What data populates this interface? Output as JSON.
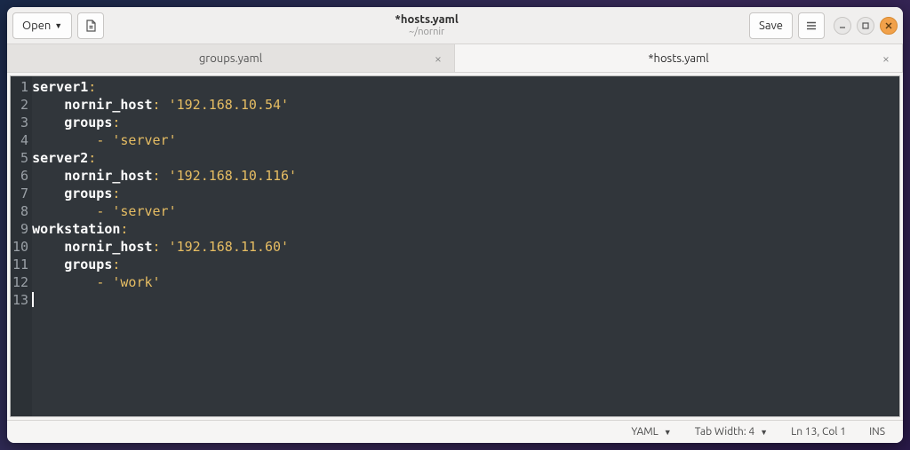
{
  "header": {
    "open_label": "Open",
    "save_label": "Save",
    "title": "*hosts.yaml",
    "subtitle": "~/nornir"
  },
  "tabs": [
    {
      "label": "groups.yaml",
      "active": false
    },
    {
      "label": "*hosts.yaml",
      "active": true
    }
  ],
  "editor": {
    "lines": [
      {
        "n": 1,
        "segments": [
          [
            "k",
            "server1"
          ],
          [
            "o",
            ":"
          ]
        ]
      },
      {
        "n": 2,
        "segments": [
          [
            "p",
            "    "
          ],
          [
            "k",
            "nornir_host"
          ],
          [
            "o",
            ":"
          ],
          [
            "p",
            " "
          ],
          [
            "s",
            "'192.168.10.54'"
          ]
        ]
      },
      {
        "n": 3,
        "segments": [
          [
            "p",
            "    "
          ],
          [
            "k",
            "groups"
          ],
          [
            "o",
            ":"
          ]
        ]
      },
      {
        "n": 4,
        "segments": [
          [
            "p",
            "        "
          ],
          [
            "o",
            "-"
          ],
          [
            "p",
            " "
          ],
          [
            "s",
            "'server'"
          ]
        ]
      },
      {
        "n": 5,
        "segments": [
          [
            "k",
            "server2"
          ],
          [
            "o",
            ":"
          ]
        ]
      },
      {
        "n": 6,
        "segments": [
          [
            "p",
            "    "
          ],
          [
            "k",
            "nornir_host"
          ],
          [
            "o",
            ":"
          ],
          [
            "p",
            " "
          ],
          [
            "s",
            "'192.168.10.116'"
          ]
        ]
      },
      {
        "n": 7,
        "segments": [
          [
            "p",
            "    "
          ],
          [
            "k",
            "groups"
          ],
          [
            "o",
            ":"
          ]
        ]
      },
      {
        "n": 8,
        "segments": [
          [
            "p",
            "        "
          ],
          [
            "o",
            "-"
          ],
          [
            "p",
            " "
          ],
          [
            "s",
            "'server'"
          ]
        ]
      },
      {
        "n": 9,
        "segments": [
          [
            "k",
            "workstation"
          ],
          [
            "o",
            ":"
          ]
        ]
      },
      {
        "n": 10,
        "segments": [
          [
            "p",
            "    "
          ],
          [
            "k",
            "nornir_host"
          ],
          [
            "o",
            ":"
          ],
          [
            "p",
            " "
          ],
          [
            "s",
            "'192.168.11.60'"
          ]
        ]
      },
      {
        "n": 11,
        "segments": [
          [
            "p",
            "    "
          ],
          [
            "k",
            "groups"
          ],
          [
            "o",
            ":"
          ]
        ]
      },
      {
        "n": 12,
        "segments": [
          [
            "p",
            "        "
          ],
          [
            "o",
            "-"
          ],
          [
            "p",
            " "
          ],
          [
            "s",
            "'work'"
          ]
        ]
      },
      {
        "n": 13,
        "segments": [],
        "cursor": true
      }
    ]
  },
  "status": {
    "language": "YAML",
    "tab_width": "Tab Width: 4",
    "position": "Ln 13, Col 1",
    "insert_mode": "INS"
  }
}
